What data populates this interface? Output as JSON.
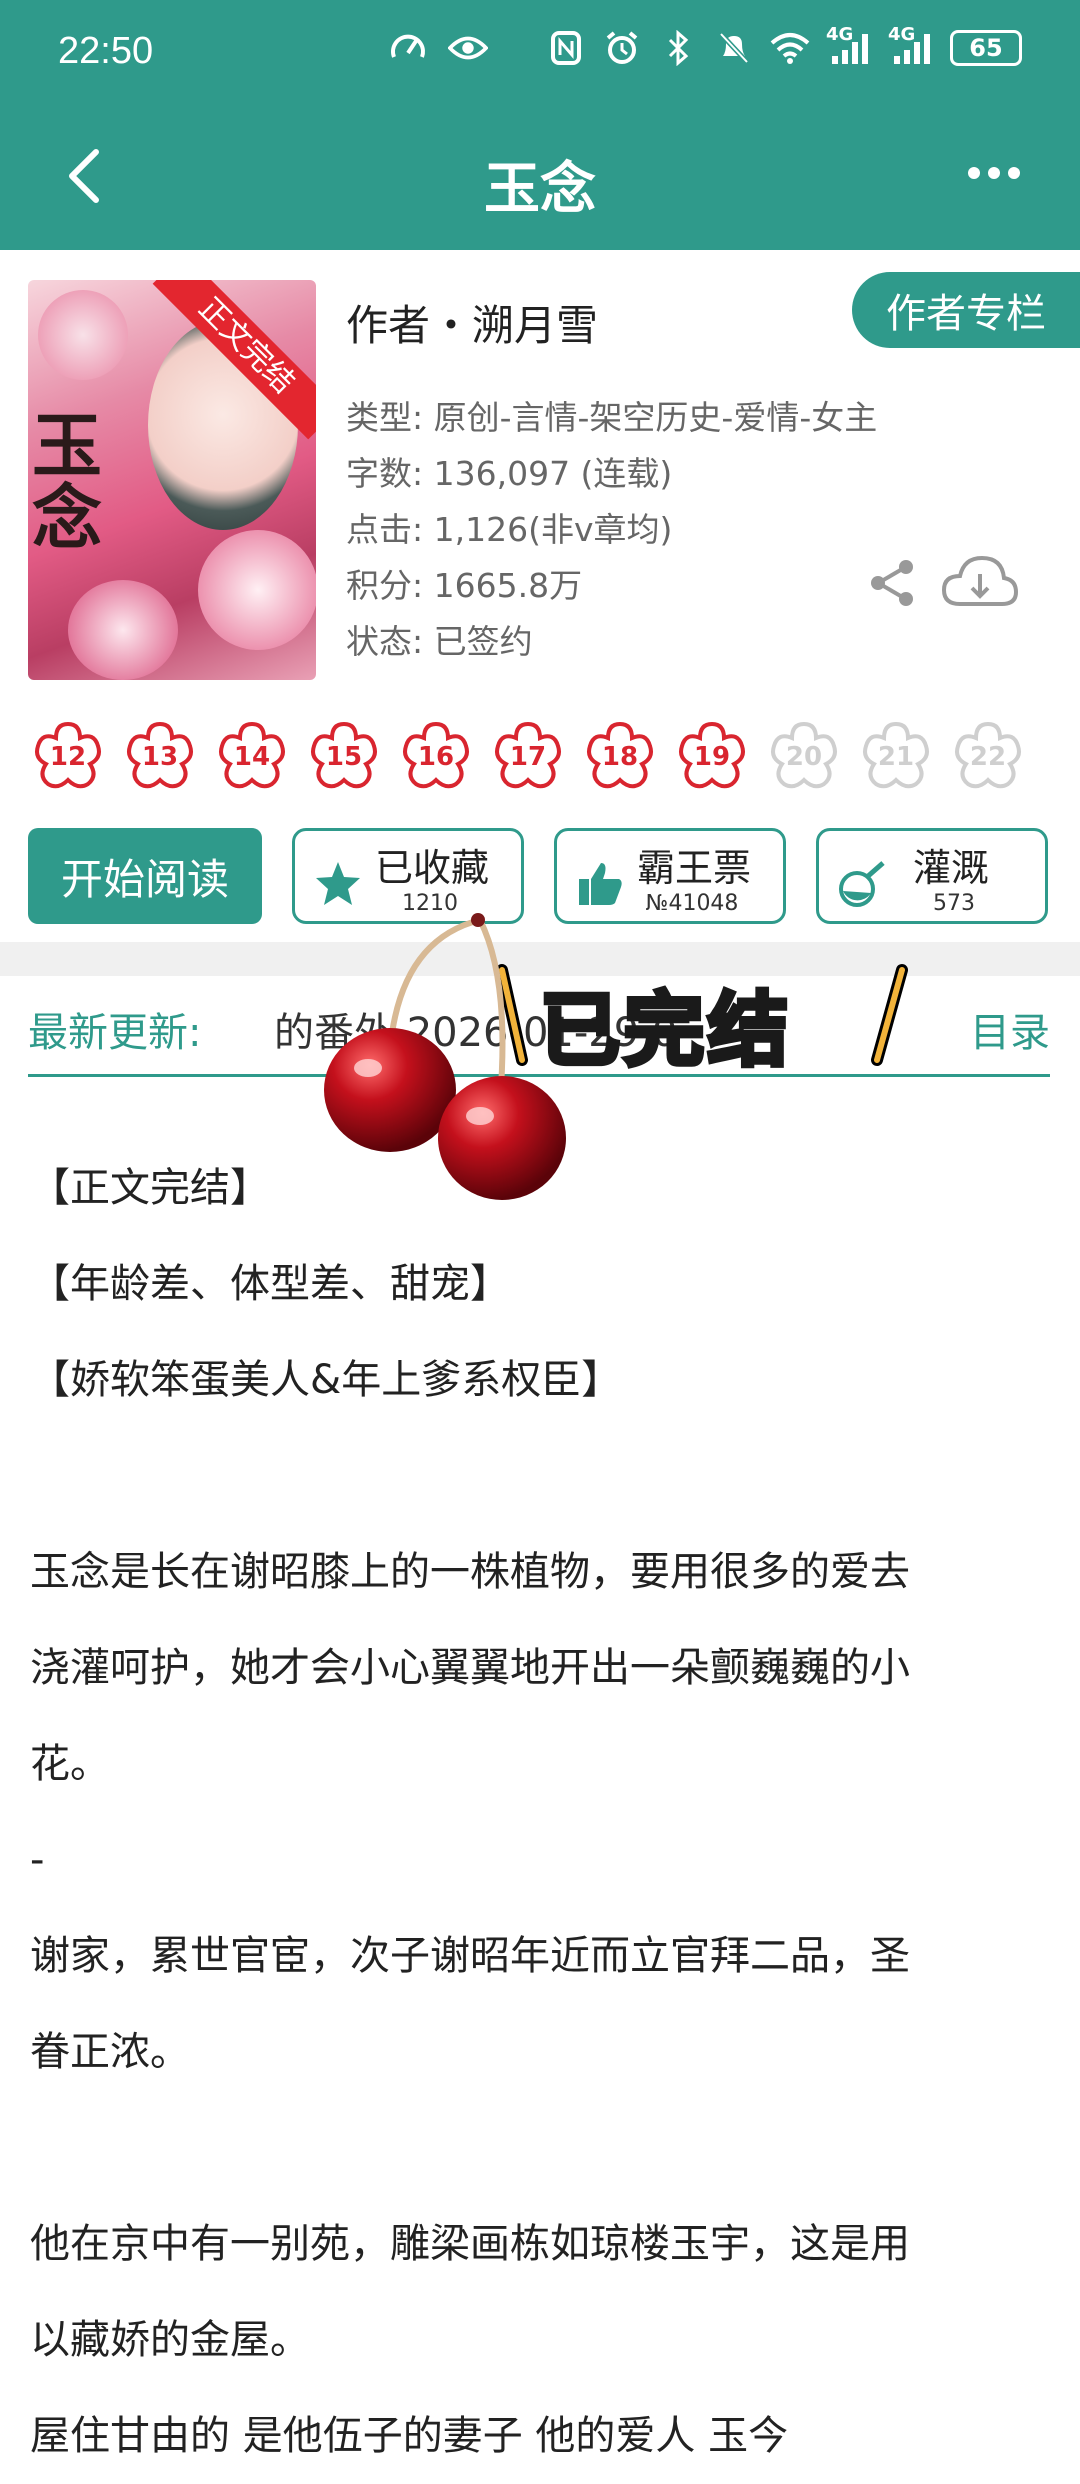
{
  "status_bar": {
    "time": "22:50",
    "battery": "65",
    "network_1": "4G",
    "network_2": "4G"
  },
  "header": {
    "title": "玉念"
  },
  "book": {
    "cover_ribbon": "正文完结",
    "cover_title": "玉念",
    "author_line": "作者・溯月雪",
    "author_column_button": "作者专栏",
    "meta": [
      "类型: 原创-言情-架空历史-爱情-女主",
      "字数: 136,097 (连载)",
      "点击: 1,126(非v章均)",
      "积分: 1665.8万",
      "状态: 已签约"
    ]
  },
  "ratings": {
    "labels": [
      "12",
      "13",
      "14",
      "15",
      "16",
      "17",
      "18",
      "19",
      "20",
      "21",
      "22"
    ],
    "active_count": 8,
    "active_color": "#d9252f",
    "inactive_color": "#cfcfcf"
  },
  "actions": {
    "read_button": "开始阅读",
    "collect": {
      "label": "已收藏",
      "count": "1210"
    },
    "tickets": {
      "label": "霸王票",
      "count": "№41048"
    },
    "water": {
      "label": "灌溉",
      "count": "573"
    }
  },
  "update": {
    "label": "最新更新:",
    "text": "的番外 2026-01-29 0",
    "toc": "目录",
    "sticker": "\\已完结/"
  },
  "description": [
    "【正文完结】",
    "【年龄差、体型差、甜宠】",
    "【娇软笨蛋美人&年上爹系权臣】",
    "",
    "玉念是长在谢昭膝上的一株植物，要用很多的爱去",
    "浇灌呵护，她才会小心翼翼地开出一朵颤巍巍的小",
    "花。",
    "-",
    "谢家，累世官宦，次子谢昭年近而立官拜二品，圣",
    "眷正浓。",
    "",
    "他在京中有一别苑，雕梁画栋如琼楼玉宇，这是用",
    "以藏娇的金屋。",
    "屋住甘由的 是他伍子的妻子 他的爱人 玉今"
  ],
  "colors": {
    "theme": "#2f9a8b",
    "accent_red": "#d9252f"
  }
}
